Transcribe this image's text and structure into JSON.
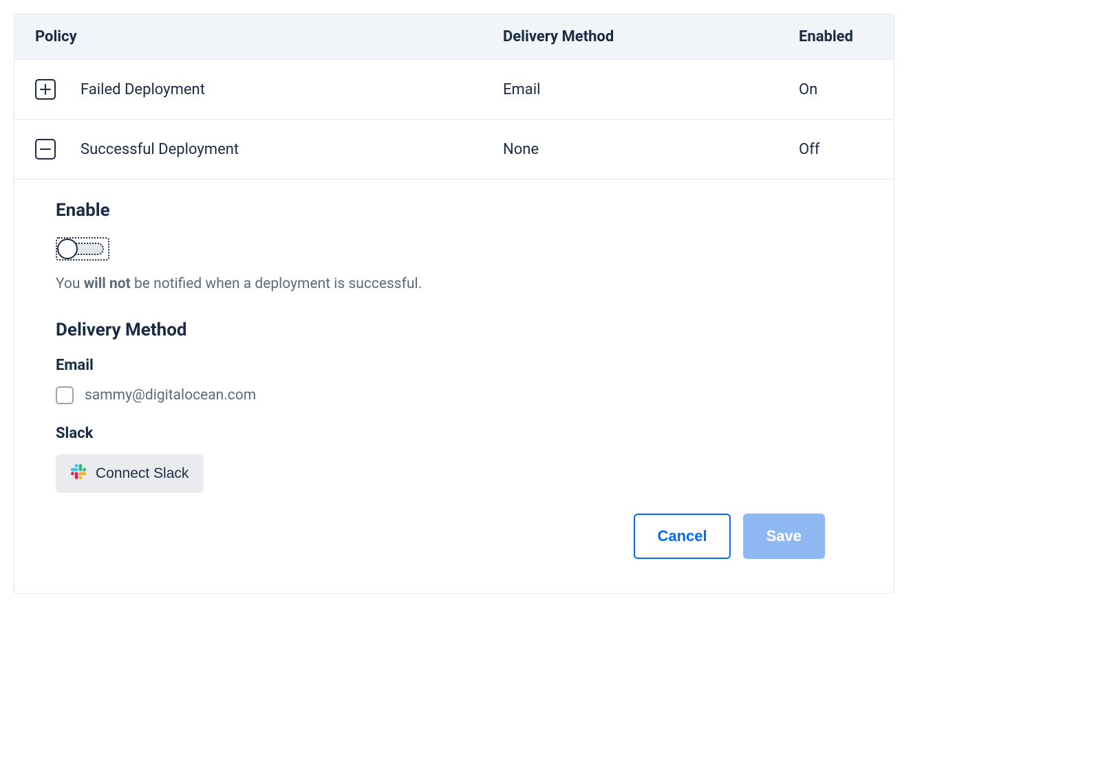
{
  "columns": {
    "policy": "Policy",
    "delivery": "Delivery Method",
    "enabled": "Enabled"
  },
  "rows": [
    {
      "policy": "Failed Deployment",
      "delivery": "Email",
      "enabled": "On",
      "expanded": false
    },
    {
      "policy": "Successful Deployment",
      "delivery": "None",
      "enabled": "Off",
      "expanded": true
    }
  ],
  "details": {
    "enable_heading": "Enable",
    "desc_prefix": "You ",
    "desc_bold": "will not",
    "desc_suffix": " be notified when a deployment is successful.",
    "delivery_heading": "Delivery Method",
    "email_heading": "Email",
    "email_value": "sammy@digitalocean.com",
    "slack_heading": "Slack",
    "connect_slack_label": "Connect Slack"
  },
  "actions": {
    "cancel": "Cancel",
    "save": "Save"
  }
}
